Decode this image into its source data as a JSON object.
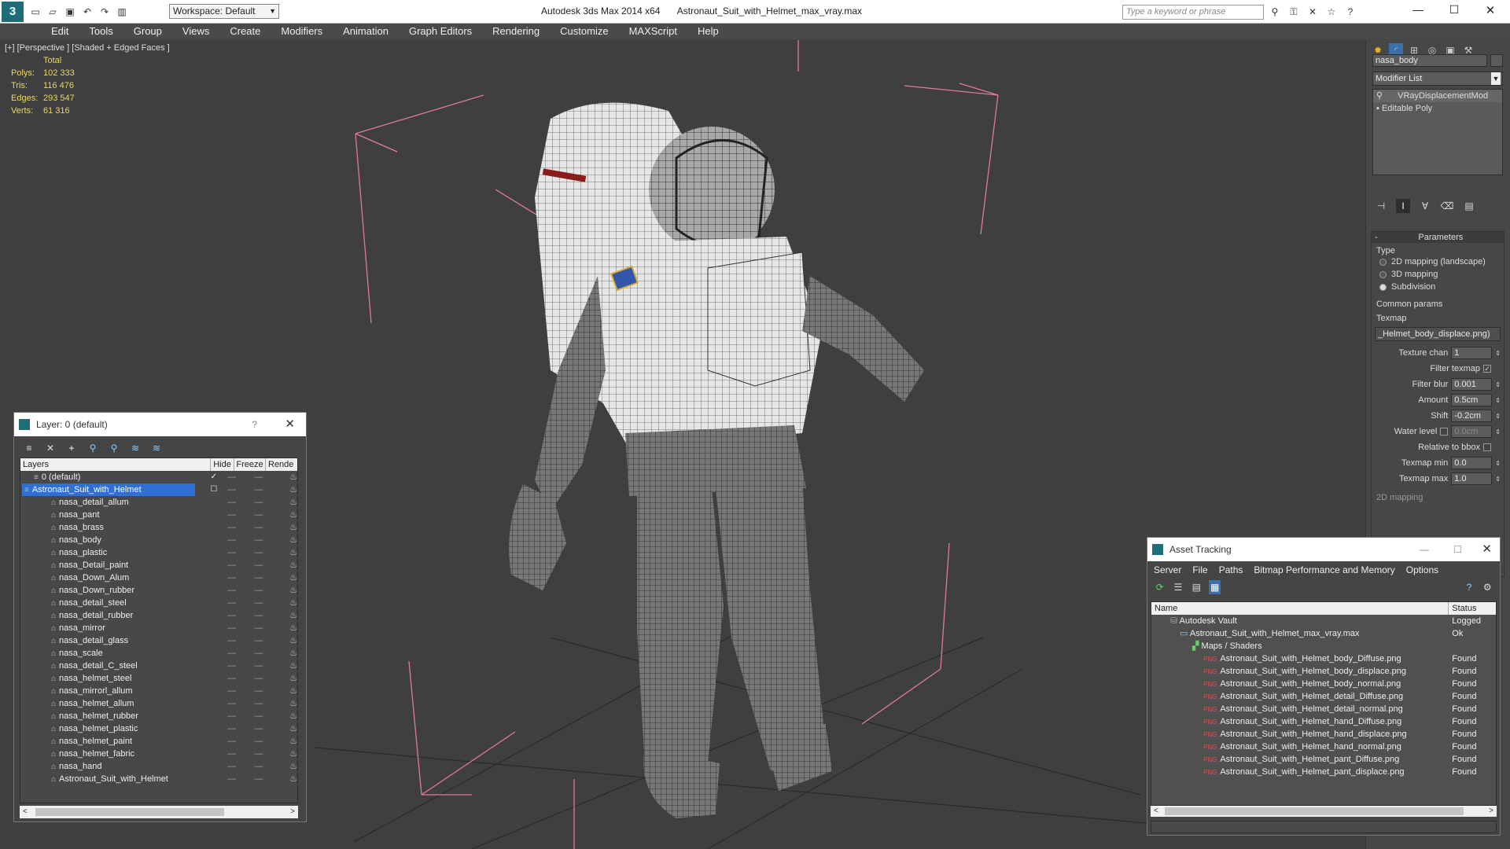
{
  "titlebar": {
    "app_title": "Autodesk 3ds Max  2014 x64",
    "file_name": "Astronaut_Suit_with_Helmet_max_vray.max",
    "workspace": "Workspace: Default",
    "search_placeholder": "Type a keyword or phrase"
  },
  "menu": [
    "Edit",
    "Tools",
    "Group",
    "Views",
    "Create",
    "Modifiers",
    "Animation",
    "Graph Editors",
    "Rendering",
    "Customize",
    "MAXScript",
    "Help"
  ],
  "viewport": {
    "label": "[+] [Perspective ] [Shaded + Edged Faces ]",
    "stats": {
      "header": "Total",
      "rows": [
        {
          "label": "Polys:",
          "value": "102 333"
        },
        {
          "label": "Tris:",
          "value": "116 476"
        },
        {
          "label": "Edges:",
          "value": "293 547"
        },
        {
          "label": "Verts:",
          "value": "61 316"
        }
      ]
    }
  },
  "command_panel": {
    "object_name": "nasa_body",
    "modifier_list": "Modifier List",
    "stack": [
      "VRayDisplacementMod",
      "Editable Poly"
    ],
    "parameters_title": "Parameters",
    "type_label": "Type",
    "type_options": [
      "2D mapping (landscape)",
      "3D mapping",
      "Subdivision"
    ],
    "common_params": "Common params",
    "texmap_label": "Texmap",
    "texmap_value": "_Helmet_body_displace.png)",
    "texture_chan_label": "Texture chan",
    "texture_chan_value": "1",
    "filter_texmap": "Filter texmap",
    "filter_blur_label": "Filter blur",
    "filter_blur_value": "0.001",
    "amount_label": "Amount",
    "amount_value": "0.5cm",
    "shift_label": "Shift",
    "shift_value": "-0.2cm",
    "water_level_label": "Water level",
    "water_level_value": "0.0cm",
    "relative_bbox": "Relative to bbox",
    "texmap_min_label": "Texmap min",
    "texmap_min_value": "0.0",
    "texmap_max_label": "Texmap max",
    "texmap_max_value": "1.0",
    "cut_label": "2D mapping"
  },
  "layer_window": {
    "title": "Layer: 0 (default)",
    "columns": [
      "Layers",
      "Hide",
      "Freeze",
      "Rende"
    ],
    "default_layer": "0 (default)",
    "selected_layer": "Astronaut_Suit_with_Helmet",
    "items": [
      "nasa_detail_allum",
      "nasa_pant",
      "nasa_brass",
      "nasa_body",
      "nasa_plastic",
      "nasa_Detail_paint",
      "nasa_Down_Alum",
      "nasa_Down_rubber",
      "nasa_detail_steel",
      "nasa_detail_rubber",
      "nasa_mirror",
      "nasa_detail_glass",
      "nasa_scale",
      "nasa_detail_C_steel",
      "nasa_helmet_steel",
      "nasa_mirrorl_allum",
      "nasa_helmet_allum",
      "nasa_helmet_rubber",
      "nasa_helmet_plastic",
      "nasa_helmet_paint",
      "nasa_helmet_fabric",
      "nasa_hand",
      "Astronaut_Suit_with_Helmet"
    ]
  },
  "asset_window": {
    "title": "Asset Tracking",
    "menu": [
      "Server",
      "File",
      "Paths",
      "Bitmap Performance and Memory",
      "Options"
    ],
    "col_name": "Name",
    "col_status": "Status",
    "vault": {
      "name": "Autodesk Vault",
      "status": "Logged"
    },
    "max_file": {
      "name": "Astronaut_Suit_with_Helmet_max_vray.max",
      "status": "Ok"
    },
    "maps_label": "Maps / Shaders",
    "maps": [
      {
        "name": "Astronaut_Suit_with_Helmet_body_Diffuse.png",
        "status": "Found"
      },
      {
        "name": "Astronaut_Suit_with_Helmet_body_displace.png",
        "status": "Found"
      },
      {
        "name": "Astronaut_Suit_with_Helmet_body_normal.png",
        "status": "Found"
      },
      {
        "name": "Astronaut_Suit_with_Helmet_detail_Diffuse.png",
        "status": "Found"
      },
      {
        "name": "Astronaut_Suit_with_Helmet_detail_normal.png",
        "status": "Found"
      },
      {
        "name": "Astronaut_Suit_with_Helmet_hand_Diffuse.png",
        "status": "Found"
      },
      {
        "name": "Astronaut_Suit_with_Helmet_hand_displace.png",
        "status": "Found"
      },
      {
        "name": "Astronaut_Suit_with_Helmet_hand_normal.png",
        "status": "Found"
      },
      {
        "name": "Astronaut_Suit_with_Helmet_pant_Diffuse.png",
        "status": "Found"
      },
      {
        "name": "Astronaut_Suit_with_Helmet_pant_displace.png",
        "status": "Found"
      }
    ]
  },
  "colors": {
    "selection": "#2f6fd6",
    "stats": "#e8d860",
    "bbox": "#e07a9a"
  }
}
